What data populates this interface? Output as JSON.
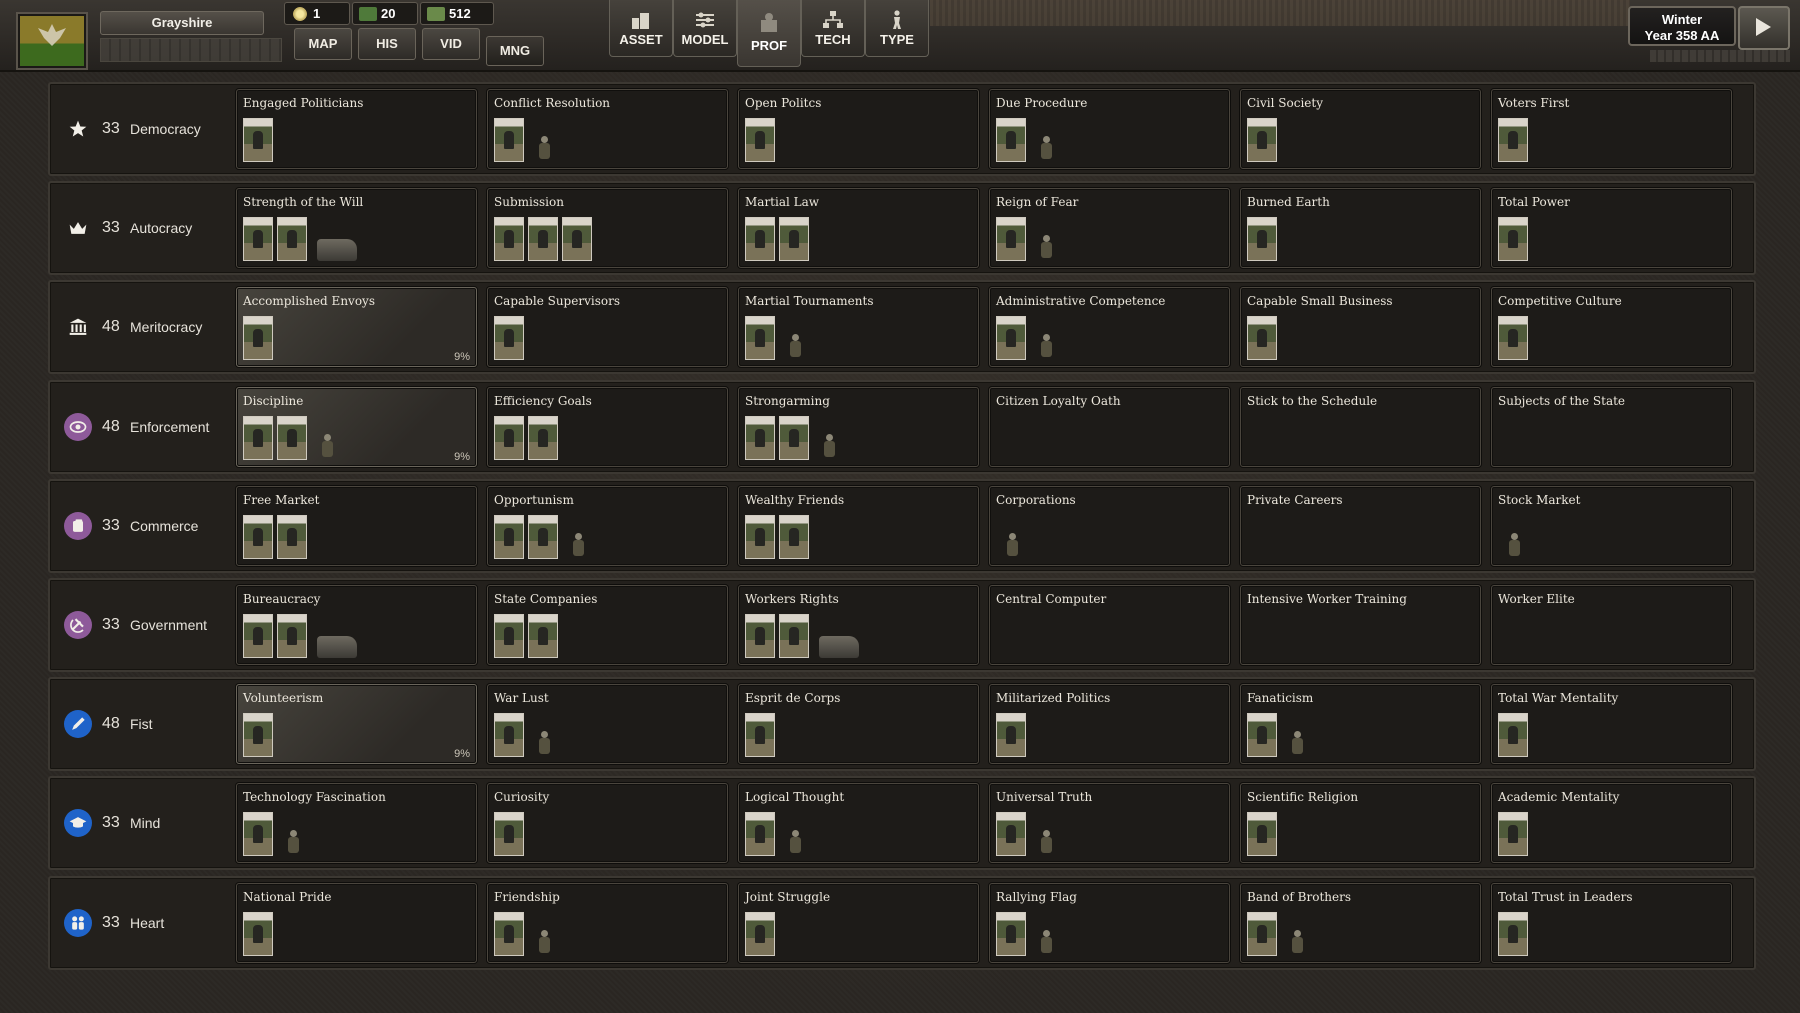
{
  "header": {
    "nation_name": "Grayshire",
    "resources": [
      {
        "icon": "sun-icon",
        "value": "1"
      },
      {
        "icon": "fist-icon",
        "value": "20"
      },
      {
        "icon": "money-icon",
        "value": "512"
      }
    ],
    "nav_tabs": [
      "MAP",
      "HIS",
      "VID",
      "MNG"
    ],
    "active_nav_tab": "MNG",
    "tools": [
      {
        "label": "ASSET",
        "icon": "buildings-icon"
      },
      {
        "label": "MODEL",
        "icon": "sliders-icon"
      },
      {
        "label": "PROF",
        "icon": "profile-icon"
      },
      {
        "label": "TECH",
        "icon": "tech-tree-icon"
      },
      {
        "label": "TYPE",
        "icon": "soldier-icon"
      }
    ],
    "active_tool": "PROF",
    "season": "Winter",
    "year": "Year 358 AA"
  },
  "categories": [
    {
      "value": "33",
      "name": "Democracy",
      "icon": "star-icon",
      "color": "",
      "policies": [
        {
          "title": "Engaged Politicians",
          "units": [
            "card"
          ],
          "adopted": false
        },
        {
          "title": "Conflict Resolution",
          "units": [
            "card",
            "fig"
          ],
          "adopted": false
        },
        {
          "title": "Open Politcs",
          "units": [
            "card"
          ],
          "adopted": false
        },
        {
          "title": "Due Procedure",
          "units": [
            "card",
            "fig"
          ],
          "adopted": false
        },
        {
          "title": "Civil Society",
          "units": [
            "card"
          ],
          "adopted": false
        },
        {
          "title": "Voters First",
          "units": [
            "card"
          ],
          "adopted": false
        }
      ]
    },
    {
      "value": "33",
      "name": "Autocracy",
      "icon": "crown-icon",
      "color": "",
      "policies": [
        {
          "title": "Strength of the Will",
          "units": [
            "card",
            "card",
            "vehicle"
          ],
          "adopted": false
        },
        {
          "title": "Submission",
          "units": [
            "card",
            "card",
            "card"
          ],
          "adopted": false
        },
        {
          "title": "Martial Law",
          "units": [
            "card",
            "card"
          ],
          "adopted": false
        },
        {
          "title": "Reign of Fear",
          "units": [
            "card",
            "fig"
          ],
          "adopted": false
        },
        {
          "title": "Burned Earth",
          "units": [
            "card"
          ],
          "adopted": false
        },
        {
          "title": "Total Power",
          "units": [
            "card"
          ],
          "adopted": false
        }
      ]
    },
    {
      "value": "48",
      "name": "Meritocracy",
      "icon": "institution-icon",
      "color": "",
      "policies": [
        {
          "title": "Accomplished Envoys",
          "units": [
            "card"
          ],
          "adopted": true,
          "progress": "9%"
        },
        {
          "title": "Capable Supervisors",
          "units": [
            "card"
          ],
          "adopted": false
        },
        {
          "title": "Martial Tournaments",
          "units": [
            "card",
            "fig"
          ],
          "adopted": false
        },
        {
          "title": "Administrative Competence",
          "units": [
            "card",
            "fig"
          ],
          "adopted": false
        },
        {
          "title": "Capable Small Business",
          "units": [
            "card"
          ],
          "adopted": false
        },
        {
          "title": "Competitive Culture",
          "units": [
            "card"
          ],
          "adopted": false
        }
      ]
    },
    {
      "value": "48",
      "name": "Enforcement",
      "icon": "eye-icon",
      "color": "#8e5a9a",
      "policies": [
        {
          "title": "Discipline",
          "units": [
            "card",
            "card",
            "fig"
          ],
          "adopted": true,
          "progress": "9%"
        },
        {
          "title": "Efficiency Goals",
          "units": [
            "card",
            "card"
          ],
          "adopted": false
        },
        {
          "title": "Strongarming",
          "units": [
            "card",
            "card",
            "fig"
          ],
          "adopted": false
        },
        {
          "title": "Citizen Loyalty Oath",
          "units": [],
          "adopted": false
        },
        {
          "title": "Stick to the Schedule",
          "units": [],
          "adopted": false
        },
        {
          "title": "Subjects of the State",
          "units": [],
          "adopted": false
        }
      ]
    },
    {
      "value": "33",
      "name": "Commerce",
      "icon": "coins-icon",
      "color": "#8e5a9a",
      "policies": [
        {
          "title": "Free Market",
          "units": [
            "card",
            "card"
          ],
          "adopted": false
        },
        {
          "title": "Opportunism",
          "units": [
            "card",
            "card",
            "fig"
          ],
          "adopted": false
        },
        {
          "title": "Wealthy Friends",
          "units": [
            "card",
            "card"
          ],
          "adopted": false
        },
        {
          "title": "Corporations",
          "units": [
            "fig"
          ],
          "adopted": false
        },
        {
          "title": "Private Careers",
          "units": [],
          "adopted": false
        },
        {
          "title": "Stock Market",
          "units": [
            "fig"
          ],
          "adopted": false
        }
      ]
    },
    {
      "value": "33",
      "name": "Government",
      "icon": "hammer-icon",
      "color": "#8e5a9a",
      "policies": [
        {
          "title": "Bureaucracy",
          "units": [
            "card",
            "card",
            "vehicle"
          ],
          "adopted": false
        },
        {
          "title": "State Companies",
          "units": [
            "card",
            "card"
          ],
          "adopted": false
        },
        {
          "title": "Workers Rights",
          "units": [
            "card",
            "card",
            "vehicle"
          ],
          "adopted": false
        },
        {
          "title": "Central Computer",
          "units": [],
          "adopted": false
        },
        {
          "title": "Intensive Worker Training",
          "units": [],
          "adopted": false
        },
        {
          "title": "Worker Elite",
          "units": [],
          "adopted": false
        }
      ]
    },
    {
      "value": "48",
      "name": "Fist",
      "icon": "pen-icon",
      "color": "#1f63c9",
      "policies": [
        {
          "title": "Volunteerism",
          "units": [
            "card"
          ],
          "adopted": true,
          "progress": "9%"
        },
        {
          "title": "War Lust",
          "units": [
            "card",
            "fig"
          ],
          "adopted": false
        },
        {
          "title": "Esprit de Corps",
          "units": [
            "card"
          ],
          "adopted": false
        },
        {
          "title": "Militarized Politics",
          "units": [
            "card"
          ],
          "adopted": false
        },
        {
          "title": "Fanaticism",
          "units": [
            "card",
            "fig"
          ],
          "adopted": false
        },
        {
          "title": "Total War Mentality",
          "units": [
            "card"
          ],
          "adopted": false
        }
      ]
    },
    {
      "value": "33",
      "name": "Mind",
      "icon": "graduation-cap-icon",
      "color": "#1f63c9",
      "policies": [
        {
          "title": "Technology Fascination",
          "units": [
            "card",
            "fig"
          ],
          "adopted": false
        },
        {
          "title": "Curiosity",
          "units": [
            "card"
          ],
          "adopted": false
        },
        {
          "title": "Logical Thought",
          "units": [
            "card",
            "fig"
          ],
          "adopted": false
        },
        {
          "title": "Universal Truth",
          "units": [
            "card",
            "fig"
          ],
          "adopted": false
        },
        {
          "title": "Scientific Religion",
          "units": [
            "card"
          ],
          "adopted": false
        },
        {
          "title": "Academic Mentality",
          "units": [
            "card"
          ],
          "adopted": false
        }
      ]
    },
    {
      "value": "33",
      "name": "Heart",
      "icon": "people-icon",
      "color": "#1f63c9",
      "policies": [
        {
          "title": "National Pride",
          "units": [
            "card"
          ],
          "adopted": false
        },
        {
          "title": "Friendship",
          "units": [
            "card",
            "fig"
          ],
          "adopted": false
        },
        {
          "title": "Joint Struggle",
          "units": [
            "card"
          ],
          "adopted": false
        },
        {
          "title": "Rallying Flag",
          "units": [
            "card",
            "fig"
          ],
          "adopted": false
        },
        {
          "title": "Band of Brothers",
          "units": [
            "card",
            "fig"
          ],
          "adopted": false
        },
        {
          "title": "Total Trust in Leaders",
          "units": [
            "card"
          ],
          "adopted": false
        }
      ]
    }
  ]
}
